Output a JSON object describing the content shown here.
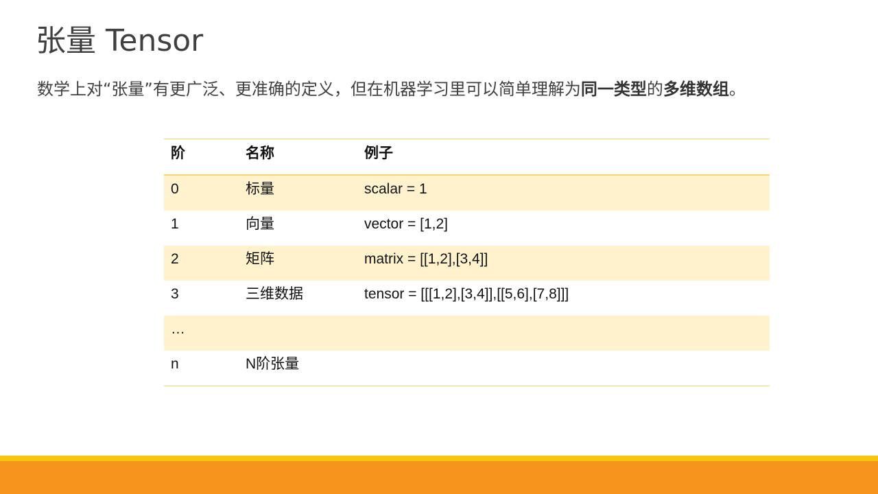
{
  "slide": {
    "title": "张量 Tensor",
    "subtitle": {
      "part1": "数学上对“张量”有更广泛、更准确的定义，但在机器学习里可以简单理解为",
      "bold1": "同一类型",
      "part2": "的",
      "bold2": "多维数组",
      "part3": "。"
    }
  },
  "table": {
    "headers": [
      "阶",
      "名称",
      "例子"
    ],
    "rows": [
      [
        "0",
        "标量",
        "scalar = 1"
      ],
      [
        "1",
        "向量",
        "vector = [1,2]"
      ],
      [
        "2",
        "矩阵",
        "matrix = [[1,2],[3,4]]"
      ],
      [
        "3",
        "三维数据",
        "tensor = [[[1,2],[3,4]],[[5,6],[7,8]]]"
      ],
      [
        "…",
        "",
        ""
      ],
      [
        "n",
        "N阶张量",
        ""
      ]
    ]
  },
  "colors": {
    "footer_yellow": "#f6c60c",
    "footer_orange": "#f7941d",
    "row_band": "#fff2cc",
    "table_rule": "#f5d670"
  }
}
